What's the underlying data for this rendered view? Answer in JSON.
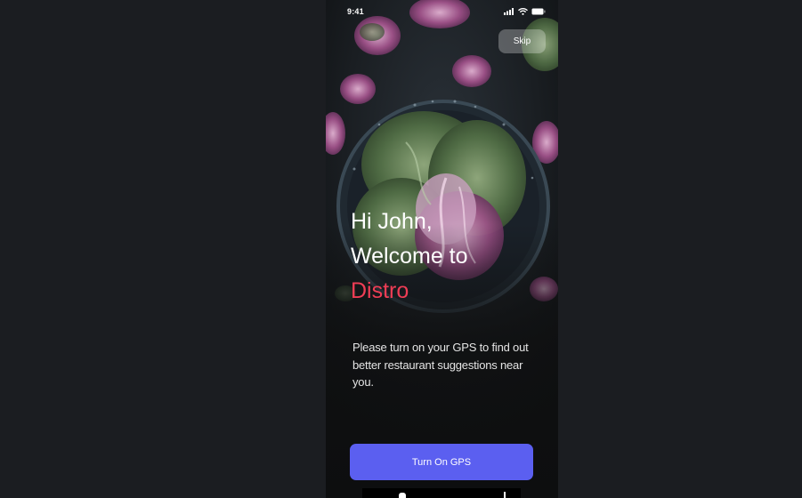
{
  "status_bar": {
    "time": "9:41",
    "icons": [
      "cellular-signal-icon",
      "wifi-icon",
      "battery-icon"
    ]
  },
  "skip": {
    "label": "Skip"
  },
  "welcome": {
    "line1": "Hi John,",
    "line2": "Welcome to",
    "brand": "Distro"
  },
  "description": "Please turn on your GPS to find out better restaurant suggestions near you.",
  "gps_button": {
    "label": "Turn On GPS"
  },
  "colors": {
    "page_background": "#1b1d21",
    "brand_accent": "#ef3d55",
    "primary_button": "#5b5ff0",
    "skip_button": "rgba(255,255,255,0.28)"
  }
}
